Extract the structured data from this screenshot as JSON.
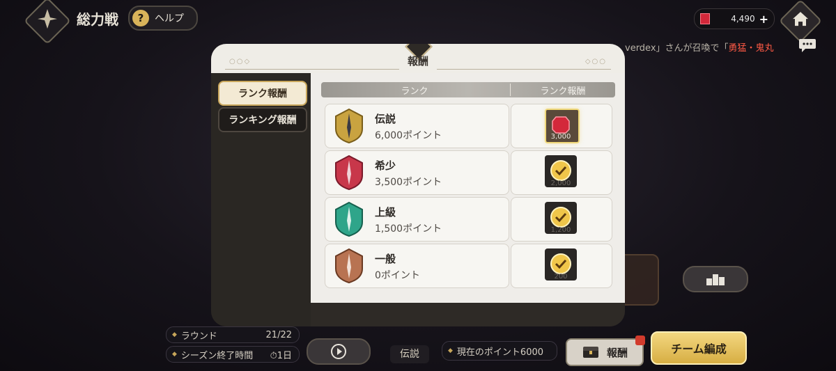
{
  "header": {
    "title": "総力戦",
    "help_label": "ヘルプ",
    "help_icon_text": "?",
    "currency_value": "4,490",
    "currency_plus": "+"
  },
  "chat": {
    "text_prefix": "verdex」さんが召喚で「",
    "text_highlight": "勇猛・鬼丸"
  },
  "bottom": {
    "round_label": "ラウンド",
    "round_value": "21/22",
    "season_label": "シーズン終了時間",
    "season_value": "1日",
    "current_rank": "伝説",
    "current_points": "現在のポイント6000",
    "reward_button": "報酬",
    "team_button": "チーム編成"
  },
  "modal": {
    "title": "報酬",
    "tabs": [
      {
        "label": "ランク報酬",
        "active": true
      },
      {
        "label": "ランキング報酬",
        "active": false
      }
    ],
    "columns": {
      "rank": "ランク",
      "reward": "ランク報酬"
    },
    "rows": [
      {
        "name": "伝説",
        "points": "6,000ポイント",
        "reward_amount": "3,000",
        "claimed": false,
        "emblem_color": "#c9a340"
      },
      {
        "name": "希少",
        "points": "3,500ポイント",
        "reward_amount": "2,000",
        "claimed": true,
        "emblem_color": "#c8374a"
      },
      {
        "name": "上級",
        "points": "1,500ポイント",
        "reward_amount": "1,200",
        "claimed": true,
        "emblem_color": "#2fa58a"
      },
      {
        "name": "一般",
        "points": "0ポイント",
        "reward_amount": "200",
        "claimed": true,
        "emblem_color": "#b87352"
      }
    ]
  },
  "colors": {
    "accent_gold": "#d9b45a",
    "gem_red": "#d3283a",
    "highlight_red": "#ff5a45"
  }
}
